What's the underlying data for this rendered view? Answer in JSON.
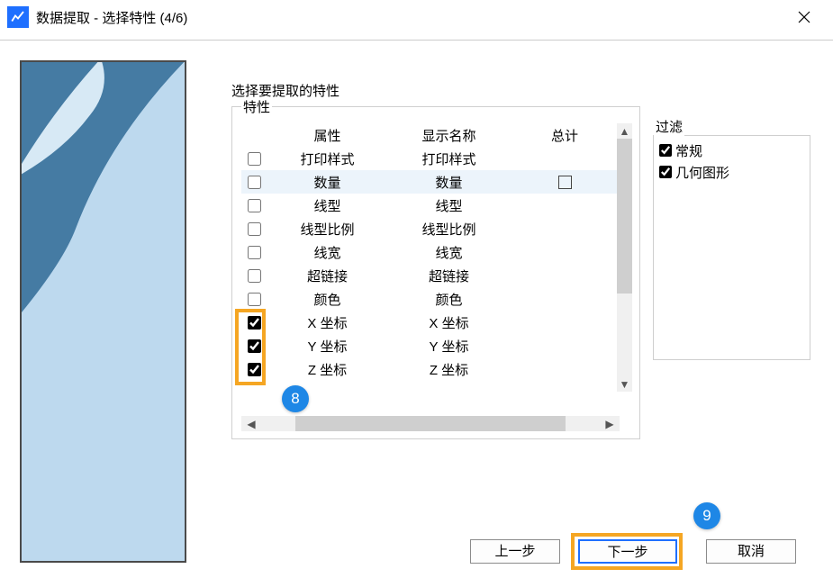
{
  "title": "数据提取 - 选择特性 (4/6)",
  "section_label": "选择要提取的特性",
  "group_properties_label": "特性",
  "group_filter_label": "过滤",
  "table": {
    "headers": {
      "col1": "属性",
      "col2": "显示名称",
      "col3": "总计"
    },
    "rows": [
      {
        "checked": false,
        "attr": "打印样式",
        "display": "打印样式",
        "selected": false,
        "has_total_box": false
      },
      {
        "checked": false,
        "attr": "数量",
        "display": "数量",
        "selected": true,
        "has_total_box": true
      },
      {
        "checked": false,
        "attr": "线型",
        "display": "线型",
        "selected": false,
        "has_total_box": false
      },
      {
        "checked": false,
        "attr": "线型比例",
        "display": "线型比例",
        "selected": false,
        "has_total_box": false
      },
      {
        "checked": false,
        "attr": "线宽",
        "display": "线宽",
        "selected": false,
        "has_total_box": false
      },
      {
        "checked": false,
        "attr": "超链接",
        "display": "超链接",
        "selected": false,
        "has_total_box": false
      },
      {
        "checked": false,
        "attr": "颜色",
        "display": "颜色",
        "selected": false,
        "has_total_box": false
      },
      {
        "checked": true,
        "attr": "X 坐标",
        "display": "X 坐标",
        "selected": false,
        "has_total_box": false
      },
      {
        "checked": true,
        "attr": "Y 坐标",
        "display": "Y 坐标",
        "selected": false,
        "has_total_box": false
      },
      {
        "checked": true,
        "attr": "Z 坐标",
        "display": "Z 坐标",
        "selected": false,
        "has_total_box": false
      }
    ]
  },
  "filters": [
    {
      "label": "常规",
      "checked": true
    },
    {
      "label": "几何图形",
      "checked": true
    }
  ],
  "buttons": {
    "prev": "上一步",
    "next": "下一步",
    "cancel": "取消"
  },
  "annotations": {
    "step8": "8",
    "step9": "9"
  }
}
